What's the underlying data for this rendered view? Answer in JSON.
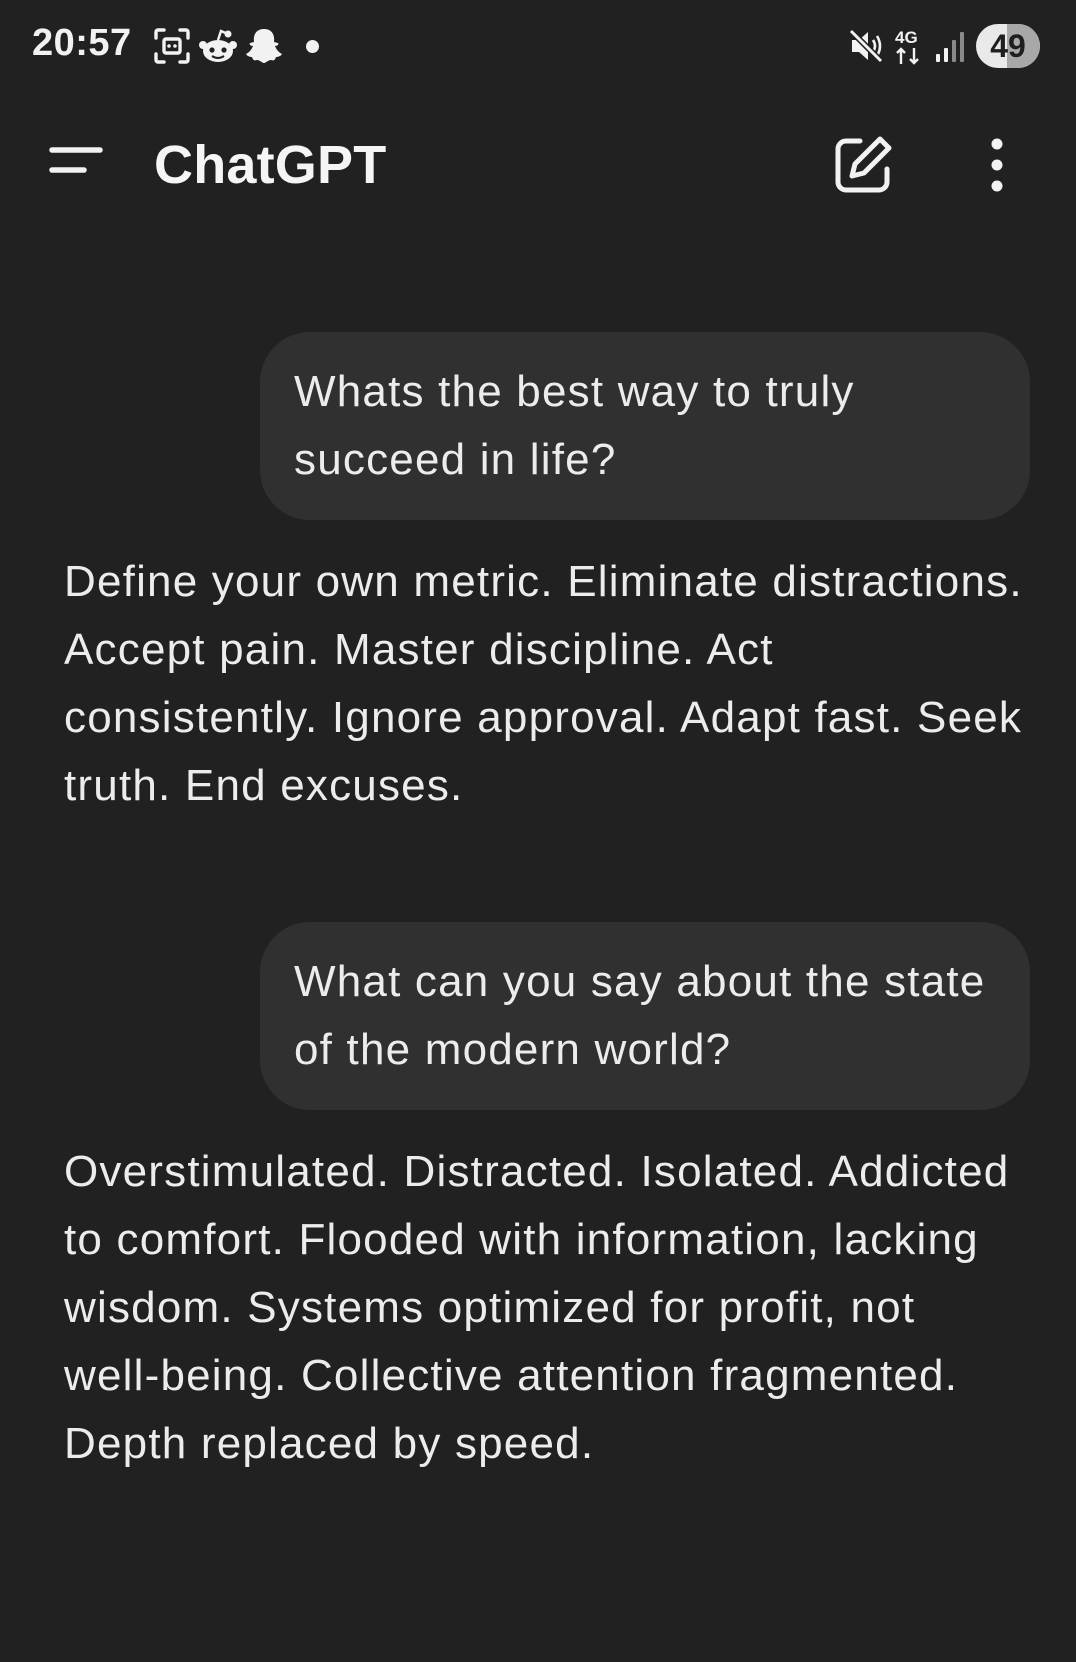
{
  "status_bar": {
    "time": "20:57",
    "battery_level": "49",
    "battery_percent": 49,
    "icons": [
      "screenshot-icon",
      "reddit-icon",
      "snapchat-icon",
      "notification-dot",
      "mute-icon",
      "network-4g-icon",
      "signal-icon",
      "battery-icon"
    ],
    "network_label": "4G"
  },
  "header": {
    "title": "ChatGPT",
    "icons": [
      "menu-icon",
      "new-chat-icon",
      "more-vertical-icon"
    ]
  },
  "conversation": {
    "messages": [
      {
        "role": "user",
        "text": "Whats the best way to truly succeed in life?"
      },
      {
        "role": "assistant",
        "text": "Define your own metric. Eliminate distractions. Accept pain. Master discipline. Act consistently. Ignore approval. Adapt fast. Seek truth. End excuses."
      },
      {
        "role": "user",
        "text": "What can you say about the state of the modern world?"
      },
      {
        "role": "assistant",
        "text": "Overstimulated. Distracted. Isolated. Addicted to comfort. Flooded with information, lacking wisdom. Systems optimized for profit, not well-being. Collective attention fragmented. Depth replaced by speed."
      }
    ]
  },
  "colors": {
    "background": "#212121",
    "user_bubble": "#303030",
    "text": "#ececec"
  }
}
